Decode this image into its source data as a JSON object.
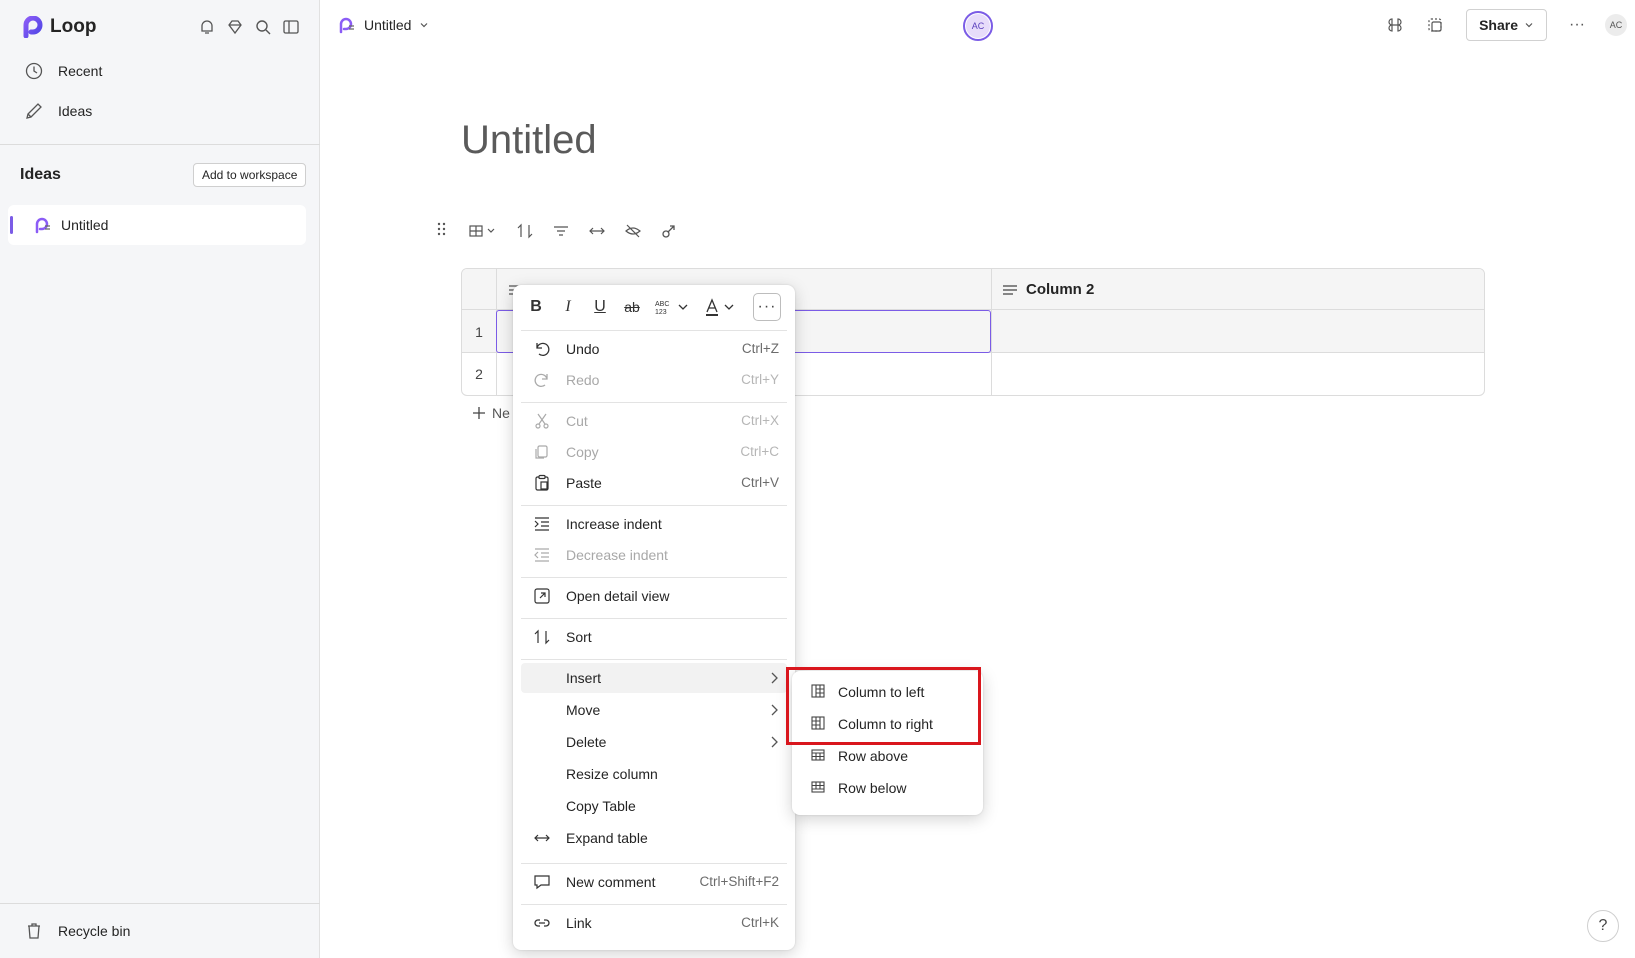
{
  "app": {
    "name": "Loop"
  },
  "sidebar": {
    "nav": [
      {
        "label": "Recent",
        "icon": "clock-icon"
      },
      {
        "label": "Ideas",
        "icon": "ideas-icon"
      }
    ],
    "section_title": "Ideas",
    "add_workspace_label": "Add to workspace",
    "pages": [
      {
        "label": "Untitled"
      }
    ],
    "recycle_label": "Recycle bin"
  },
  "header": {
    "doc_title": "Untitled",
    "avatar_initials": "AC",
    "share_label": "Share",
    "user_initials": "AC",
    "more_label": "···"
  },
  "document": {
    "title": "Untitled",
    "table": {
      "column2_header": "Column 2",
      "rows": [
        {
          "num": "1"
        },
        {
          "num": "2"
        }
      ],
      "new_row_label": "Ne"
    }
  },
  "context_menu": {
    "format": {
      "bold": "B",
      "italic": "I",
      "underline": "U",
      "strike": "ab",
      "more": "···"
    },
    "items": [
      {
        "label": "Undo",
        "shortcut": "Ctrl+Z",
        "disabled": false
      },
      {
        "label": "Redo",
        "shortcut": "Ctrl+Y",
        "disabled": true
      },
      {
        "label": "Cut",
        "shortcut": "Ctrl+X",
        "disabled": true
      },
      {
        "label": "Copy",
        "shortcut": "Ctrl+C",
        "disabled": true
      },
      {
        "label": "Paste",
        "shortcut": "Ctrl+V",
        "disabled": false
      },
      {
        "label": "Increase indent",
        "shortcut": "",
        "disabled": false
      },
      {
        "label": "Decrease indent",
        "shortcut": "",
        "disabled": true
      },
      {
        "label": "Open detail view",
        "shortcut": "",
        "disabled": false
      },
      {
        "label": "Sort",
        "shortcut": "",
        "disabled": false
      },
      {
        "label": "Insert",
        "shortcut": "",
        "disabled": false
      },
      {
        "label": "Move",
        "shortcut": "",
        "disabled": false
      },
      {
        "label": "Delete",
        "shortcut": "",
        "disabled": false
      },
      {
        "label": "Resize column",
        "shortcut": "",
        "disabled": false
      },
      {
        "label": "Copy Table",
        "shortcut": "",
        "disabled": false
      },
      {
        "label": "Expand table",
        "shortcut": "",
        "disabled": false
      },
      {
        "label": "New comment",
        "shortcut": "Ctrl+Shift+F2",
        "disabled": false
      },
      {
        "label": "Link",
        "shortcut": "Ctrl+K",
        "disabled": false
      }
    ]
  },
  "insert_submenu": {
    "items": [
      {
        "label": "Column to left"
      },
      {
        "label": "Column to right"
      },
      {
        "label": "Row above"
      },
      {
        "label": "Row below"
      }
    ]
  },
  "help_label": "?",
  "colors": {
    "accent": "#7b5ce6",
    "highlight": "#d9161d"
  }
}
